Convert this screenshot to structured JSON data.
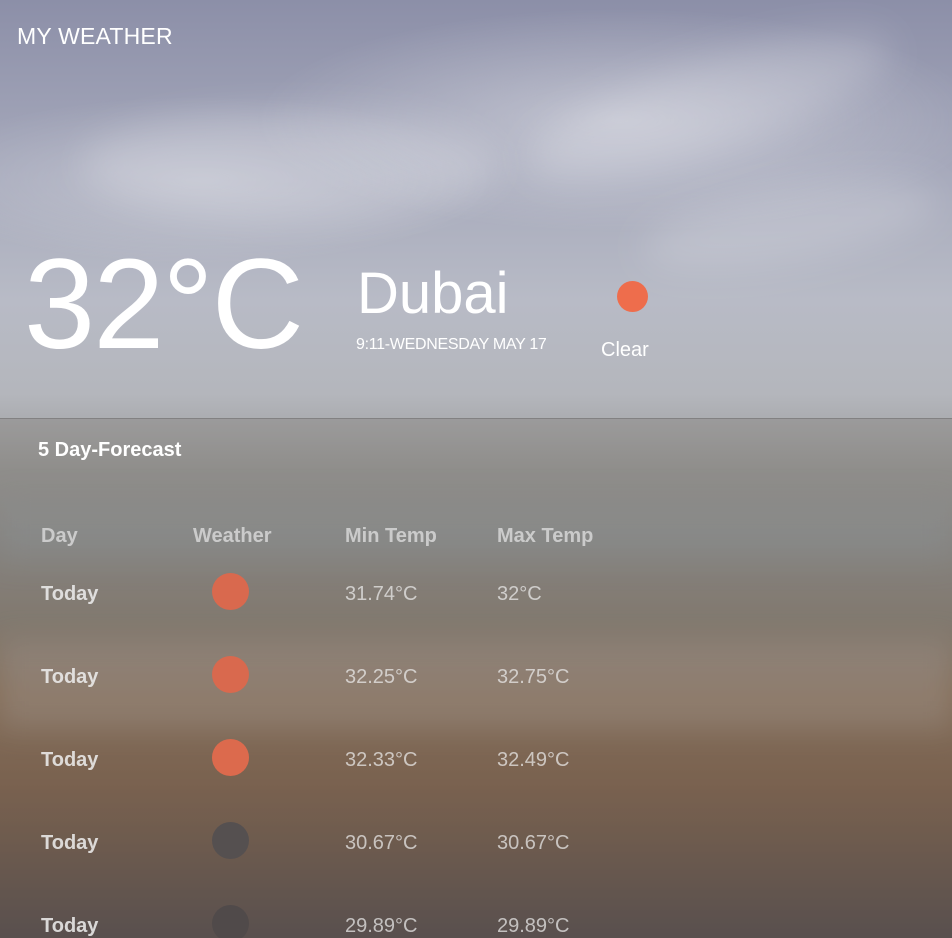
{
  "app": {
    "title": "MY WEATHER"
  },
  "current": {
    "temperature": "32°C",
    "city": "Dubai",
    "datetime": "9:11-WEDNESDAY MAY 17",
    "condition": "Clear",
    "condition_icon": "sun-icon",
    "condition_color": "#ee6d4c"
  },
  "forecast": {
    "title": "5 Day-Forecast",
    "headers": {
      "day": "Day",
      "weather": "Weather",
      "min": "Min Temp",
      "max": "Max Temp"
    },
    "rows": [
      {
        "day": "Today",
        "icon": "sun-icon",
        "icon_color": "#d9694e",
        "min": "31.74°C",
        "max": "32°C"
      },
      {
        "day": "Today",
        "icon": "sun-icon",
        "icon_color": "#d9694e",
        "min": "32.25°C",
        "max": "32.75°C"
      },
      {
        "day": "Today",
        "icon": "sun-icon",
        "icon_color": "#dc6a4d",
        "min": "32.33°C",
        "max": "32.49°C"
      },
      {
        "day": "Today",
        "icon": "moon-icon",
        "icon_color": "#555050",
        "min": "30.67°C",
        "max": "30.67°C"
      },
      {
        "day": "Today",
        "icon": "moon-icon",
        "icon_color": "#504a4a",
        "min": "29.89°C",
        "max": "29.89°C"
      }
    ]
  }
}
